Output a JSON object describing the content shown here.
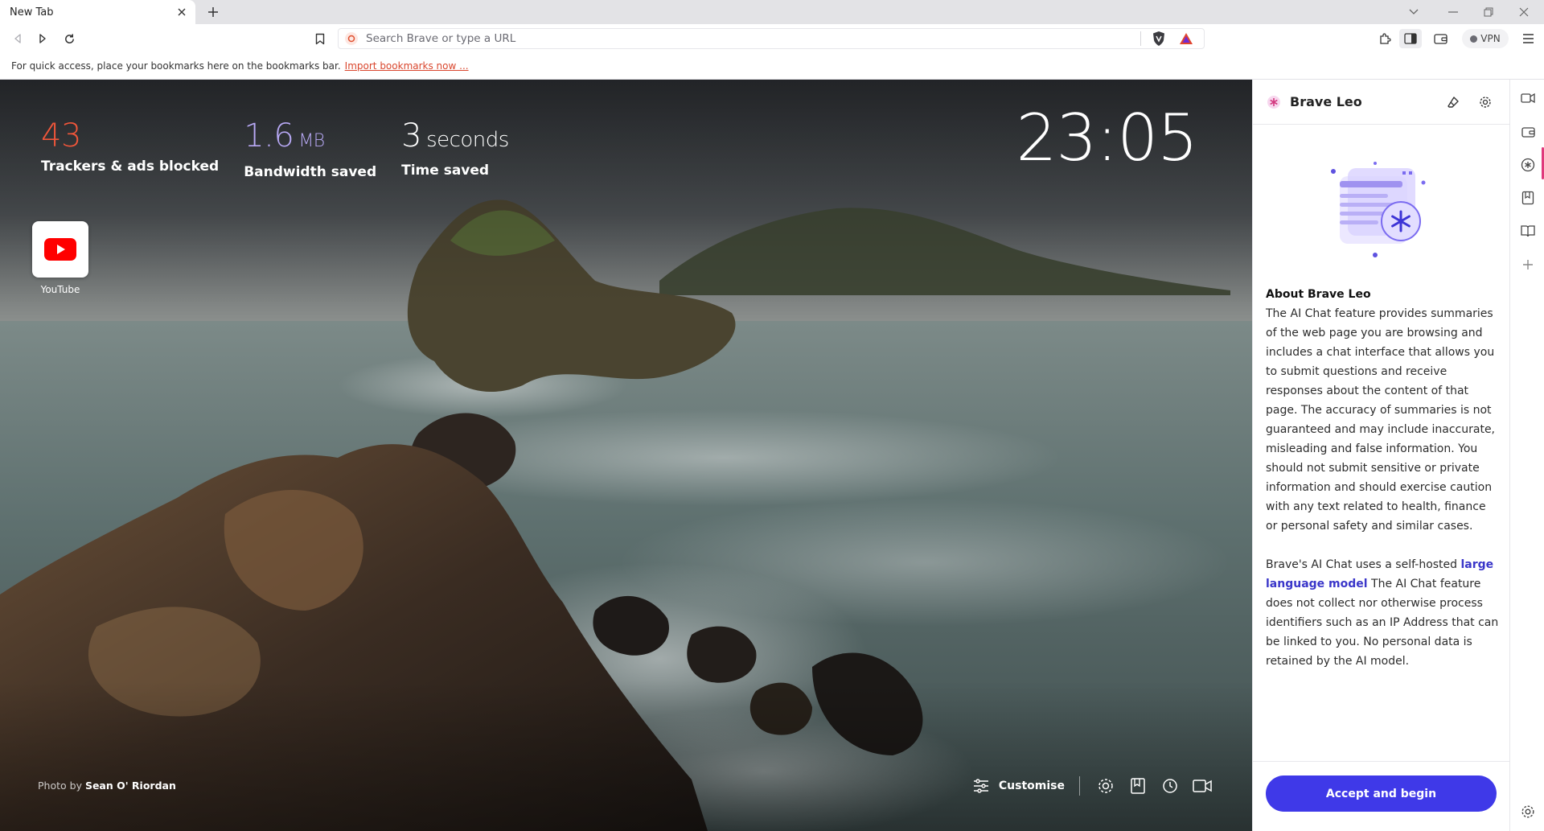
{
  "tab": {
    "title": "New Tab"
  },
  "address_bar": {
    "placeholder": "Search Brave or type a URL"
  },
  "toolbar": {
    "vpn_label": "VPN"
  },
  "bookmarks_bar": {
    "message": "For quick access, place your bookmarks here on the bookmarks bar.",
    "import_link": "Import bookmarks now ..."
  },
  "stats": {
    "trackers": {
      "value": "43",
      "label": "Trackers & ads blocked",
      "color": "#f0563a"
    },
    "bandwidth": {
      "value": "1.6",
      "unit": "MB",
      "label": "Bandwidth saved",
      "color": "#b7a8f4"
    },
    "time": {
      "value": "3",
      "unit": "seconds",
      "label": "Time saved"
    }
  },
  "clock": "23:05",
  "top_sites": [
    {
      "label": "YouTube",
      "icon": "youtube-icon"
    }
  ],
  "photo_credit": {
    "prefix": "Photo by",
    "author": "Sean O' Riordan"
  },
  "ntp_footer": {
    "customise_label": "Customise"
  },
  "leo": {
    "title": "Brave Leo",
    "about_heading": "About Brave Leo",
    "paragraph1": "The AI Chat feature provides summaries of the web page you are browsing and includes a chat interface that allows you to submit questions and receive responses about the content of that page. The accuracy of summaries is not guaranteed and may include inaccurate, misleading and false information. You should not submit sensitive or private information and should exercise caution with any text related to health, finance or personal safety and similar cases.",
    "paragraph2_before": "Brave's AI Chat uses a self-hosted ",
    "paragraph2_link": "large language model",
    "paragraph2_after": " The AI Chat feature does not collect nor otherwise process identifiers such as an IP Address that can be linked to you. No personal data is retained by the AI model.",
    "accept_button": "Accept and begin",
    "accent_color": "#3f39e8"
  }
}
